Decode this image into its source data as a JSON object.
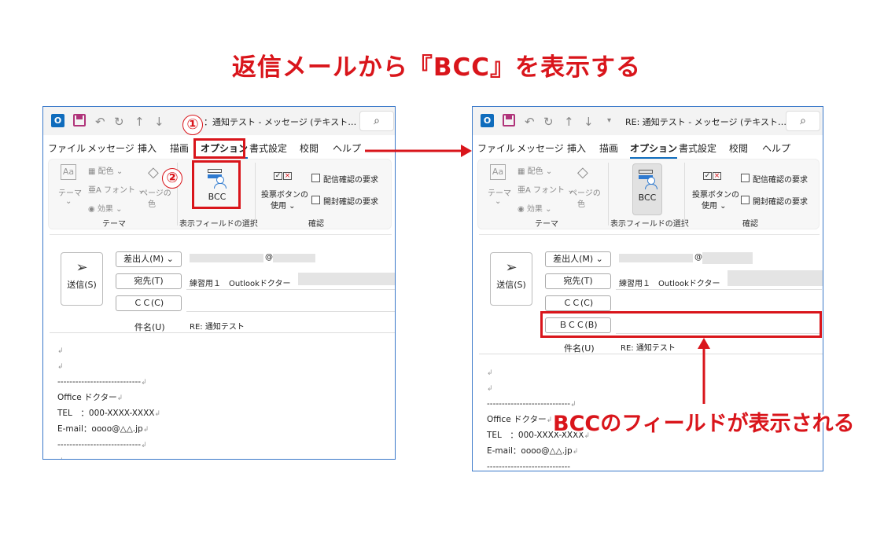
{
  "heading": "返信メールから『BCC』を表示する",
  "left_window": {
    "title": "：通知テスト - メッセージ (テキスト…",
    "step1": "①",
    "step2": "②"
  },
  "right_window": {
    "title": "RE: 通知テスト - メッセージ (テキスト…"
  },
  "menu": [
    "ファイル",
    "メッセージ",
    "挿入",
    "描画",
    "オプション",
    "書式設定",
    "校閲",
    "ヘルプ"
  ],
  "ribbon": {
    "colors": "配色",
    "fonts": "フォント",
    "effects": "効果",
    "theme_label": "テーマ",
    "page_color_l1": "ページの",
    "page_color_l2": "色",
    "theme_group": "テーマ",
    "bcc_button": "BCC",
    "show_fields_group": "表示フィールドの選択",
    "vote_l1": "投票ボタンの",
    "vote_l2": "使用",
    "delivery_receipt": "配信確認の要求",
    "read_receipt": "開封確認の要求",
    "tracking_group": "確認"
  },
  "compose": {
    "send_button": "送信(S)",
    "from_button": "差出人(M)",
    "from_at": "@",
    "to_button": "宛先(T)",
    "to_value": "練習用１　Outlookドクター",
    "cc_button": "ＣＣ(C)",
    "bcc_button": "ＢＣＣ(B)",
    "subject_label": "件名(U)",
    "subject_value": "RE: 通知テスト"
  },
  "body_lines": [
    "----------------------------",
    "Office ドクター",
    "TEL　：000-XXXX-XXXX",
    "E-mail：oooo@△△.jp",
    "----------------------------"
  ],
  "callout": "BCCのフィールドが表示される",
  "colors": {
    "accent_red": "#d9151b",
    "outlook_blue": "#0f6cbd"
  }
}
